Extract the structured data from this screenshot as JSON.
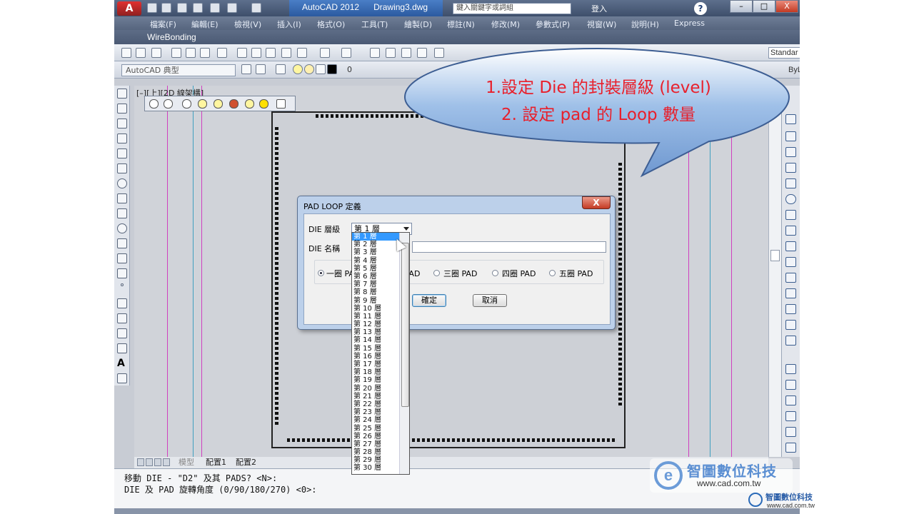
{
  "title_bar": {
    "app_name": "AutoCAD 2012",
    "document": "Drawing3.dwg",
    "search_placeholder": "鍵入關鍵字或詞組",
    "login": "登入"
  },
  "window_buttons": {
    "minimize": "–",
    "maximize": "□",
    "close": "X"
  },
  "menu": [
    "檔案(F)",
    "編輯(E)",
    "檢視(V)",
    "插入(I)",
    "格式(O)",
    "工具(T)",
    "繪製(D)",
    "標註(N)",
    "修改(M)",
    "參數式(P)",
    "視窗(W)",
    "說明(H)",
    "Express"
  ],
  "ribbon_tab": "WireBonding",
  "toolbar": {
    "style_combo": "Standar",
    "workspace": "AutoCAD 典型",
    "layer": "0",
    "bylayer": "ByL"
  },
  "viewport_label": "[–][上][2D 線架構]",
  "callout": {
    "line1": "1.設定 Die 的封裝層級 (level)",
    "line2": "2. 設定 pad 的 Loop 數量"
  },
  "dialog": {
    "title": "PAD LOOP 定義",
    "close": "X",
    "die_level_label": "DIE 層級",
    "die_level_value": "第 1 層",
    "die_name_label": "DIE 名稱",
    "die_name_value": "",
    "loop_options": [
      {
        "label": "一圈 PAD",
        "selected": true
      },
      {
        "label": "二圈 PAD",
        "selected": false
      },
      {
        "label": "三圈 PAD",
        "selected": false
      },
      {
        "label": "四圈 PAD",
        "selected": false
      },
      {
        "label": "五圈 PAD",
        "selected": false
      }
    ],
    "ok": "確定",
    "cancel": "取消"
  },
  "dropdown_items": [
    "第 1 層",
    "第 2 層",
    "第 3 層",
    "第 4 層",
    "第 5 層",
    "第 6 層",
    "第 7 層",
    "第 8 層",
    "第 9 層",
    "第 10 層",
    "第 11 層",
    "第 12 層",
    "第 13 層",
    "第 14 層",
    "第 15 層",
    "第 16 層",
    "第 17 層",
    "第 18 層",
    "第 19 層",
    "第 20 層",
    "第 21 層",
    "第 22 層",
    "第 23 層",
    "第 24 層",
    "第 25 層",
    "第 26 層",
    "第 27 層",
    "第 28 層",
    "第 29 層",
    "第 30 層"
  ],
  "layout_tabs": [
    "模型",
    "配置1",
    "配置2"
  ],
  "command_line": {
    "line1": "移動 DIE - \"D2\" 及其 PADS? <N>:",
    "line2": "DIE 及 PAD 旋轉角度 (0/90/180/270) <0>:"
  },
  "watermark": {
    "name": "智圖數位科技",
    "url": "www.cad.com.tw",
    "small_name": "智圖數位科技",
    "small_url": "www.cad.com.tw"
  },
  "colors": {
    "callout_fill": "#8fb2e0",
    "callout_text": "#e8202c",
    "selection": "#3399ff"
  }
}
